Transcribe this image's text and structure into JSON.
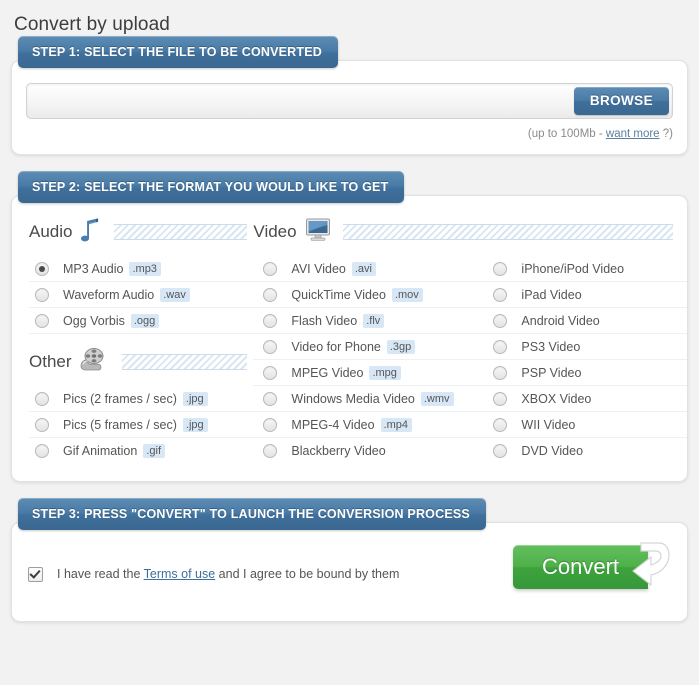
{
  "page": {
    "title": "Convert by upload"
  },
  "step1": {
    "banner": "STEP 1: SELECT THE FILE TO BE CONVERTED",
    "file_input_value": "",
    "file_input_placeholder": "",
    "browse_label": "BROWSE",
    "limit_prefix": "(up to 100Mb - ",
    "limit_link": "want more",
    "limit_suffix": " ?)"
  },
  "step2": {
    "banner": "STEP 2: SELECT THE FORMAT YOU WOULD LIKE TO GET",
    "groups": {
      "audio": {
        "title": "Audio",
        "icon": "music-note-icon",
        "options": [
          {
            "label": "MP3 Audio",
            "ext": ".mp3",
            "selected": true
          },
          {
            "label": "Waveform Audio",
            "ext": ".wav",
            "selected": false
          },
          {
            "label": "Ogg Vorbis",
            "ext": ".ogg",
            "selected": false
          }
        ]
      },
      "other": {
        "title": "Other",
        "icon": "film-reel-icon",
        "options": [
          {
            "label": "Pics (2 frames / sec)",
            "ext": ".jpg",
            "selected": false
          },
          {
            "label": "Pics (5 frames / sec)",
            "ext": ".jpg",
            "selected": false
          },
          {
            "label": "Gif Animation",
            "ext": ".gif",
            "selected": false
          }
        ]
      },
      "video": {
        "title": "Video",
        "icon": "monitor-icon",
        "options_mid": [
          {
            "label": "AVI Video",
            "ext": ".avi",
            "selected": false
          },
          {
            "label": "QuickTime Video",
            "ext": ".mov",
            "selected": false
          },
          {
            "label": "Flash Video",
            "ext": ".flv",
            "selected": false
          },
          {
            "label": "Video for Phone",
            "ext": ".3gp",
            "selected": false
          },
          {
            "label": "MPEG Video",
            "ext": ".mpg",
            "selected": false
          },
          {
            "label": "Windows Media Video",
            "ext": ".wmv",
            "selected": false
          },
          {
            "label": "MPEG-4 Video",
            "ext": ".mp4",
            "selected": false
          },
          {
            "label": "Blackberry Video",
            "ext": "",
            "selected": false
          }
        ],
        "options_right": [
          {
            "label": "iPhone/iPod Video",
            "ext": "",
            "selected": false
          },
          {
            "label": "iPad Video",
            "ext": "",
            "selected": false
          },
          {
            "label": "Android Video",
            "ext": "",
            "selected": false
          },
          {
            "label": "PS3 Video",
            "ext": "",
            "selected": false
          },
          {
            "label": "PSP Video",
            "ext": "",
            "selected": false
          },
          {
            "label": "XBOX Video",
            "ext": "",
            "selected": false
          },
          {
            "label": "WII Video",
            "ext": "",
            "selected": false
          },
          {
            "label": "DVD Video",
            "ext": "",
            "selected": false
          }
        ]
      }
    }
  },
  "step3": {
    "banner": "STEP 3: PRESS \"CONVERT\" TO LAUNCH THE CONVERSION PROCESS",
    "terms_checked": true,
    "terms_prefix": "I have read the ",
    "terms_link": "Terms of use",
    "terms_suffix": " and I agree to be bound by them",
    "convert_label": "Convert"
  },
  "colors": {
    "banner_blue": "#4a7ba6",
    "convert_green": "#4fb14a",
    "ext_badge_bg": "#d8e7f5",
    "page_bg": "#f2f2f2"
  }
}
